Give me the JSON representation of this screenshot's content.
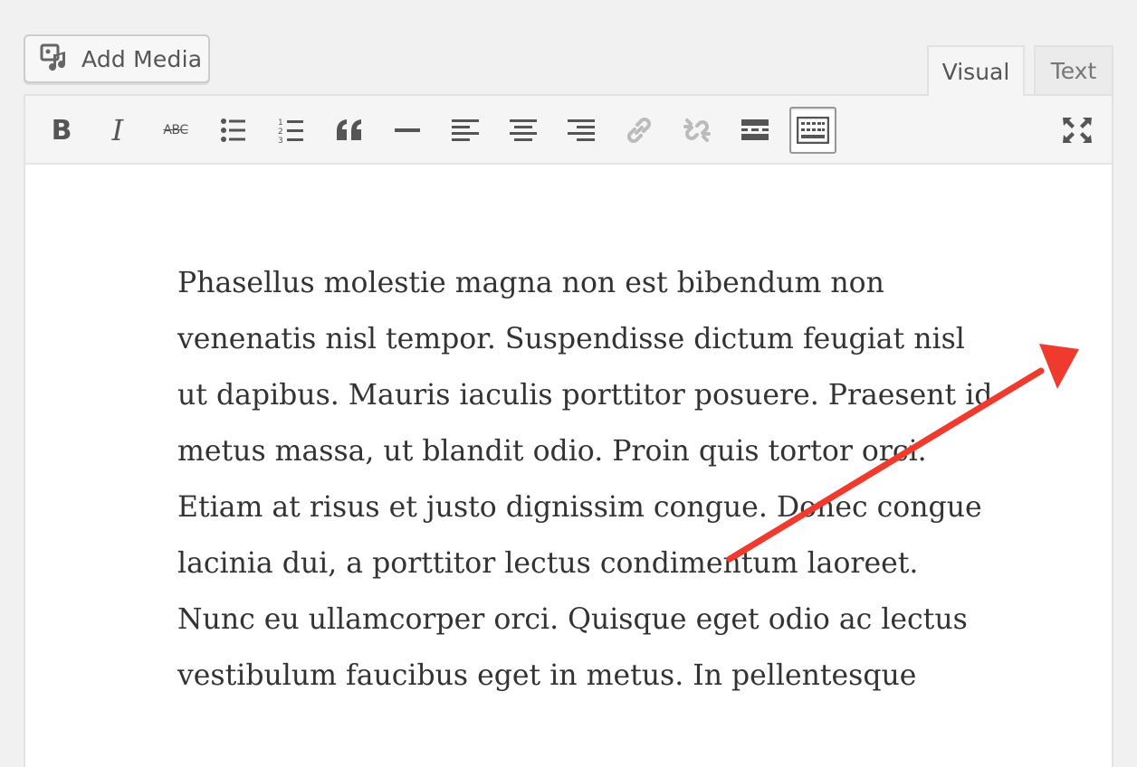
{
  "toolbar_top": {
    "add_media_label": "Add Media",
    "add_media_icon": "add-media-icon"
  },
  "tabs": {
    "visual_label": "Visual",
    "text_label": "Text",
    "active": "Visual"
  },
  "format_toolbar": {
    "bold_glyph": "B",
    "italic_glyph": "I",
    "strikethrough_glyph": "ABC",
    "buttons": [
      "bold-icon",
      "italic-icon",
      "strikethrough-icon",
      "bulleted-list-icon",
      "numbered-list-icon",
      "blockquote-icon",
      "horizontal-line-icon",
      "align-left-icon",
      "align-center-icon",
      "align-right-icon",
      "insert-link-icon",
      "remove-link-icon",
      "read-more-icon",
      "toolbar-toggle-icon",
      "fullscreen-icon"
    ],
    "active_button": "toolbar-toggle-icon"
  },
  "content": {
    "lines": [
      "Phasellus molestie magna non est bibendum non",
      "venenatis nisl tempor. Suspendisse dictum feugiat nisl",
      "ut dapibus. Mauris iaculis porttitor posuere. Praesent id",
      "metus massa, ut blandit odio. Proin quis tortor orci.",
      "Etiam at risus et justo dignissim congue. Donec congue",
      "lacinia dui, a porttitor lectus condimentum laoreet.",
      "Nunc eu ullamcorper orci. Quisque eget odio ac lectus",
      "vestibulum faucibus eget in metus. In pellentesque"
    ]
  },
  "annotation": {
    "type": "arrow",
    "color": "#f03a2e",
    "points_to": "fullscreen-area"
  },
  "colors": {
    "background": "#f1f1f1",
    "editor_bg": "#ffffff",
    "toolbar_bg": "#f5f5f5",
    "icon": "#555555",
    "icon_disabled": "#bbbbbb",
    "text": "#333333"
  }
}
